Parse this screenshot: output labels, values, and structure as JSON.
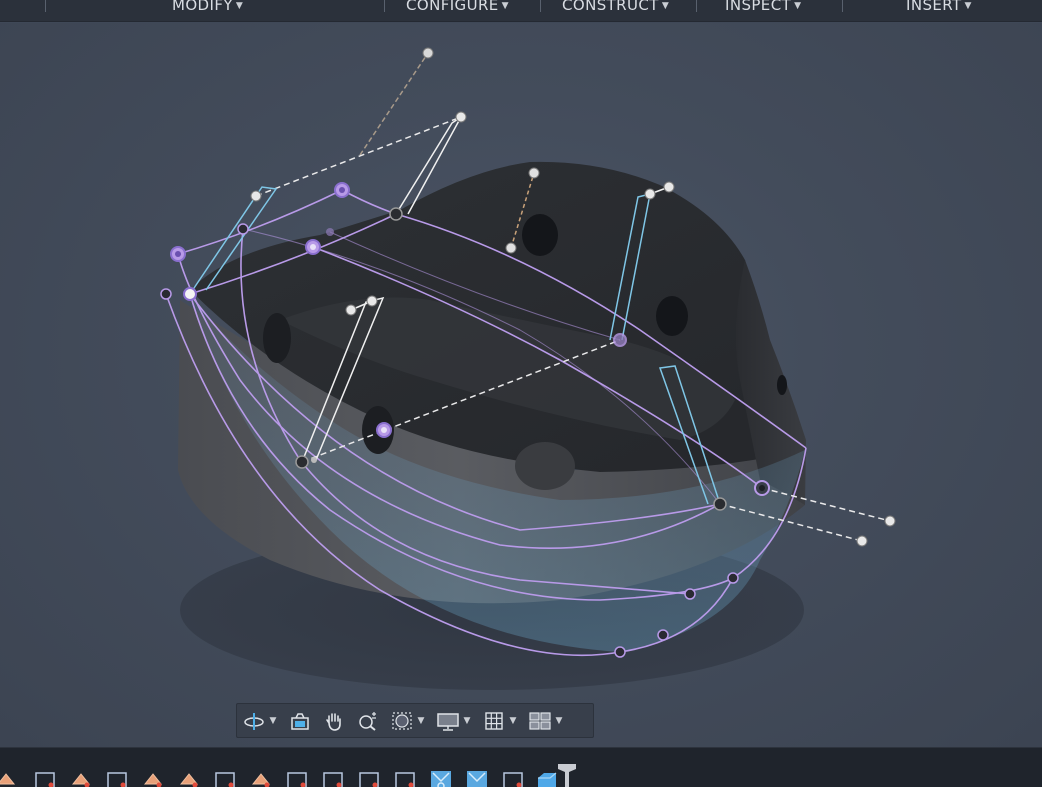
{
  "toolbar": {
    "menus": [
      {
        "label": "MODIFY"
      },
      {
        "label": "CONFIGURE"
      },
      {
        "label": "CONSTRUCT"
      },
      {
        "label": "INSPECT"
      },
      {
        "label": "INSERT"
      }
    ],
    "caret": "▼"
  },
  "colors": {
    "toolbar_bg": "#2b313b",
    "viewport_bg": "#434c5b",
    "body_dark": "#2e3136",
    "sketch_purple": "#b89ae8",
    "handle_cyan": "#7fc6e6",
    "handle_white": "#f0f0f0"
  },
  "nav_bar": {
    "tools": [
      {
        "name": "orbit-icon",
        "has_dropdown": true
      },
      {
        "name": "look-at-icon",
        "has_dropdown": false
      },
      {
        "name": "pan-hand-icon",
        "has_dropdown": false
      },
      {
        "name": "zoom-icon",
        "has_dropdown": false
      },
      {
        "name": "fit-window-icon",
        "has_dropdown": true
      },
      {
        "name": "display-settings-icon",
        "has_dropdown": true
      },
      {
        "name": "grid-icon",
        "has_dropdown": true
      },
      {
        "name": "viewports-icon",
        "has_dropdown": true
      }
    ]
  },
  "timeline": {
    "items": [
      "sketch-feature-icon",
      "sketch-icon",
      "sketch-feature-icon",
      "sketch-icon",
      "sketch-feature-icon",
      "sketch-feature-icon",
      "sketch-icon",
      "sketch-feature-icon",
      "sketch-icon",
      "sketch-icon",
      "sketch-icon",
      "sketch-icon",
      "loft-icon",
      "loft-icon",
      "sketch-icon",
      "body-icon",
      "timeline-marker-icon"
    ]
  }
}
